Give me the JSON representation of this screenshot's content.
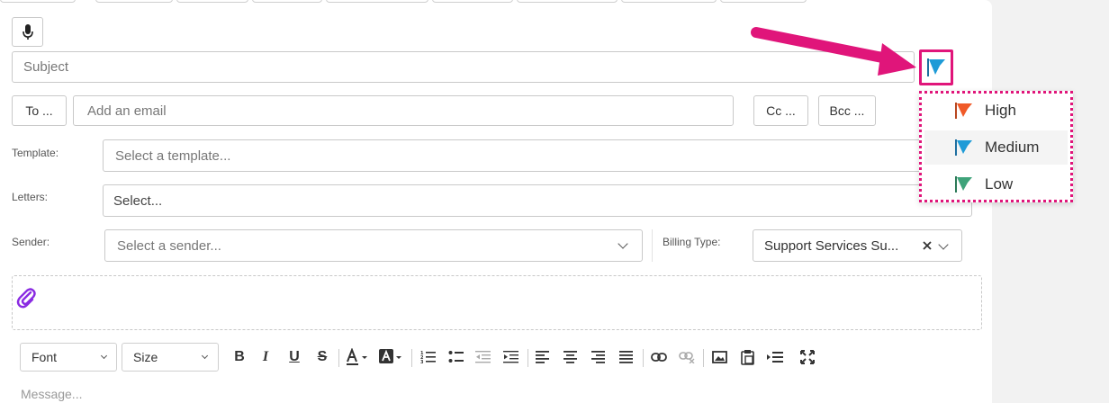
{
  "compose": {
    "subject_placeholder": "Subject",
    "to_label": "To ...",
    "to_placeholder": "Add an email",
    "cc_label": "Cc ...",
    "bcc_label": "Bcc ...",
    "template_label": "Template:",
    "template_placeholder": "Select a template...",
    "letters_label": "Letters:",
    "letters_placeholder": "Select...",
    "sender_label": "Sender:",
    "sender_placeholder": "Select a sender...",
    "billing_label": "Billing Type:",
    "billing_value": "Support Services Su...",
    "message_placeholder": "Message..."
  },
  "toolbar": {
    "font_label": "Font",
    "size_label": "Size",
    "bold": "B",
    "italic": "I",
    "underline": "U",
    "strike": "S"
  },
  "priority_menu": {
    "items": [
      {
        "label": "High",
        "color": "#f05a28"
      },
      {
        "label": "Medium",
        "color": "#1e9bd7"
      },
      {
        "label": "Low",
        "color": "#3fa37a"
      }
    ]
  },
  "colors": {
    "highlight": "#e0157a",
    "attach_icon": "#8a2be2"
  },
  "icons": [
    "microphone-icon",
    "flag-icon",
    "paperclip-icon",
    "clear-icon",
    "chevron-down-icon"
  ]
}
